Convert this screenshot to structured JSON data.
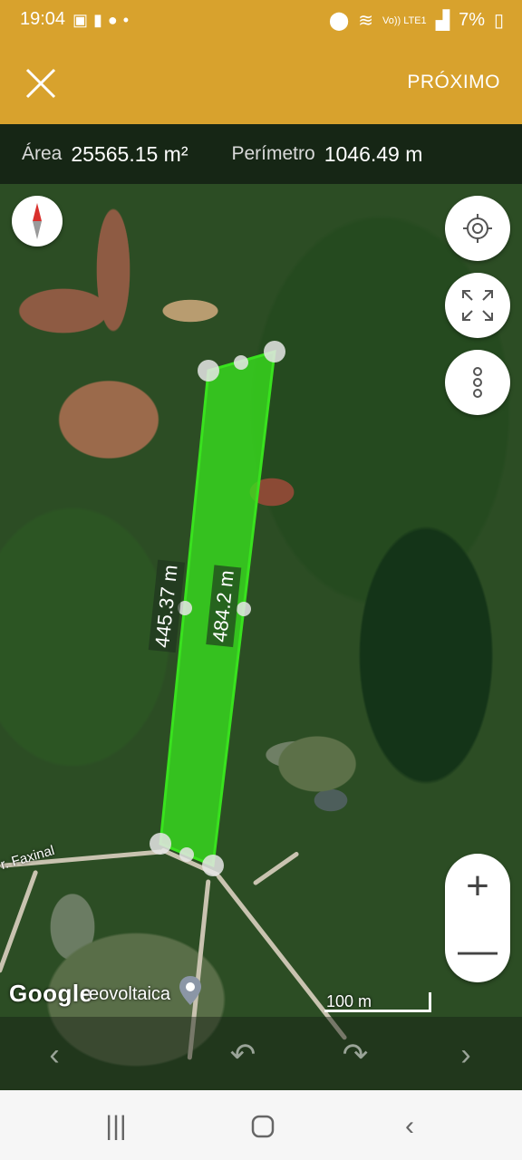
{
  "status_bar": {
    "time": "19:04",
    "left_icons": [
      "image-icon",
      "alert-icon",
      "chat-icon",
      "dot-icon"
    ],
    "network": "Vo)) LTE1",
    "battery": "7%"
  },
  "toolbar": {
    "close_icon": "close-icon",
    "next_label": "PRÓXIMO"
  },
  "measure": {
    "area_label": "Área",
    "area_value": "25565.15 m²",
    "perimeter_label": "Perímetro",
    "perimeter_value": "1046.49 m"
  },
  "map": {
    "segment_left": "445.37 m",
    "segment_right": "484.2 m",
    "google_label": "Google",
    "place_label": "eovoltaica",
    "road_label": "r. Faxinal",
    "scale_label": "100 m",
    "polygon_color": "#39e21e",
    "buttons": [
      "compass-icon",
      "my-location-icon",
      "fit-bounds-icon",
      "more-options-icon"
    ],
    "zoom_in": "+",
    "zoom_out": "—"
  },
  "edit_controls": [
    "prev-point-icon",
    "undo-icon",
    "redo-icon",
    "next-point-icon"
  ],
  "navbar": [
    "recent-apps-icon",
    "home-icon",
    "back-icon"
  ]
}
